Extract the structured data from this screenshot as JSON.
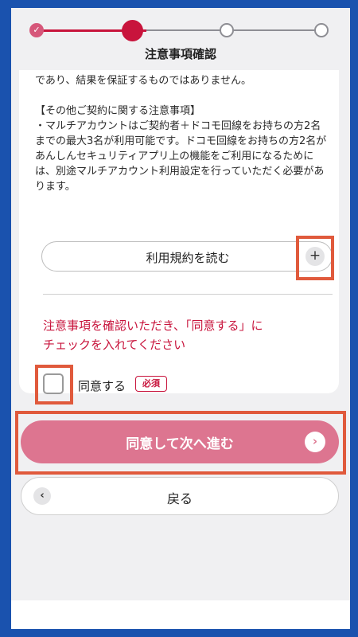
{
  "stepper": {
    "done_check": "✓",
    "current_label": "注意事項確認"
  },
  "notice": {
    "text": "であり、結果を保証するものではありません。\n\n【その他ご契約に関する注意事項】\n・マルチアカウントはご契約者＋ドコモ回線をお持ちの方2名までの最大3名が利用可能です。ドコモ回線をお持ちの方2名があんしんセキュリティアプリ上の機能をご利用になるためには、別途マルチアカウント利用設定を行っていただく必要があります。"
  },
  "terms": {
    "label": "利用規約を読む",
    "expand_icon": "+"
  },
  "warning": {
    "text": "注意事項を確認いただき、「同意する」に\nチェックを入れてください"
  },
  "agree": {
    "label": "同意する",
    "badge": "必須",
    "checked": false
  },
  "actions": {
    "next_label": "同意して次へ進む",
    "next_arrow": "›",
    "back_label": "戻る",
    "back_arrow": "‹"
  },
  "colors": {
    "accent": "#c8143c",
    "primary_button": "#dd7590",
    "highlight": "#e05a3c",
    "frame": "#1a52ae"
  }
}
